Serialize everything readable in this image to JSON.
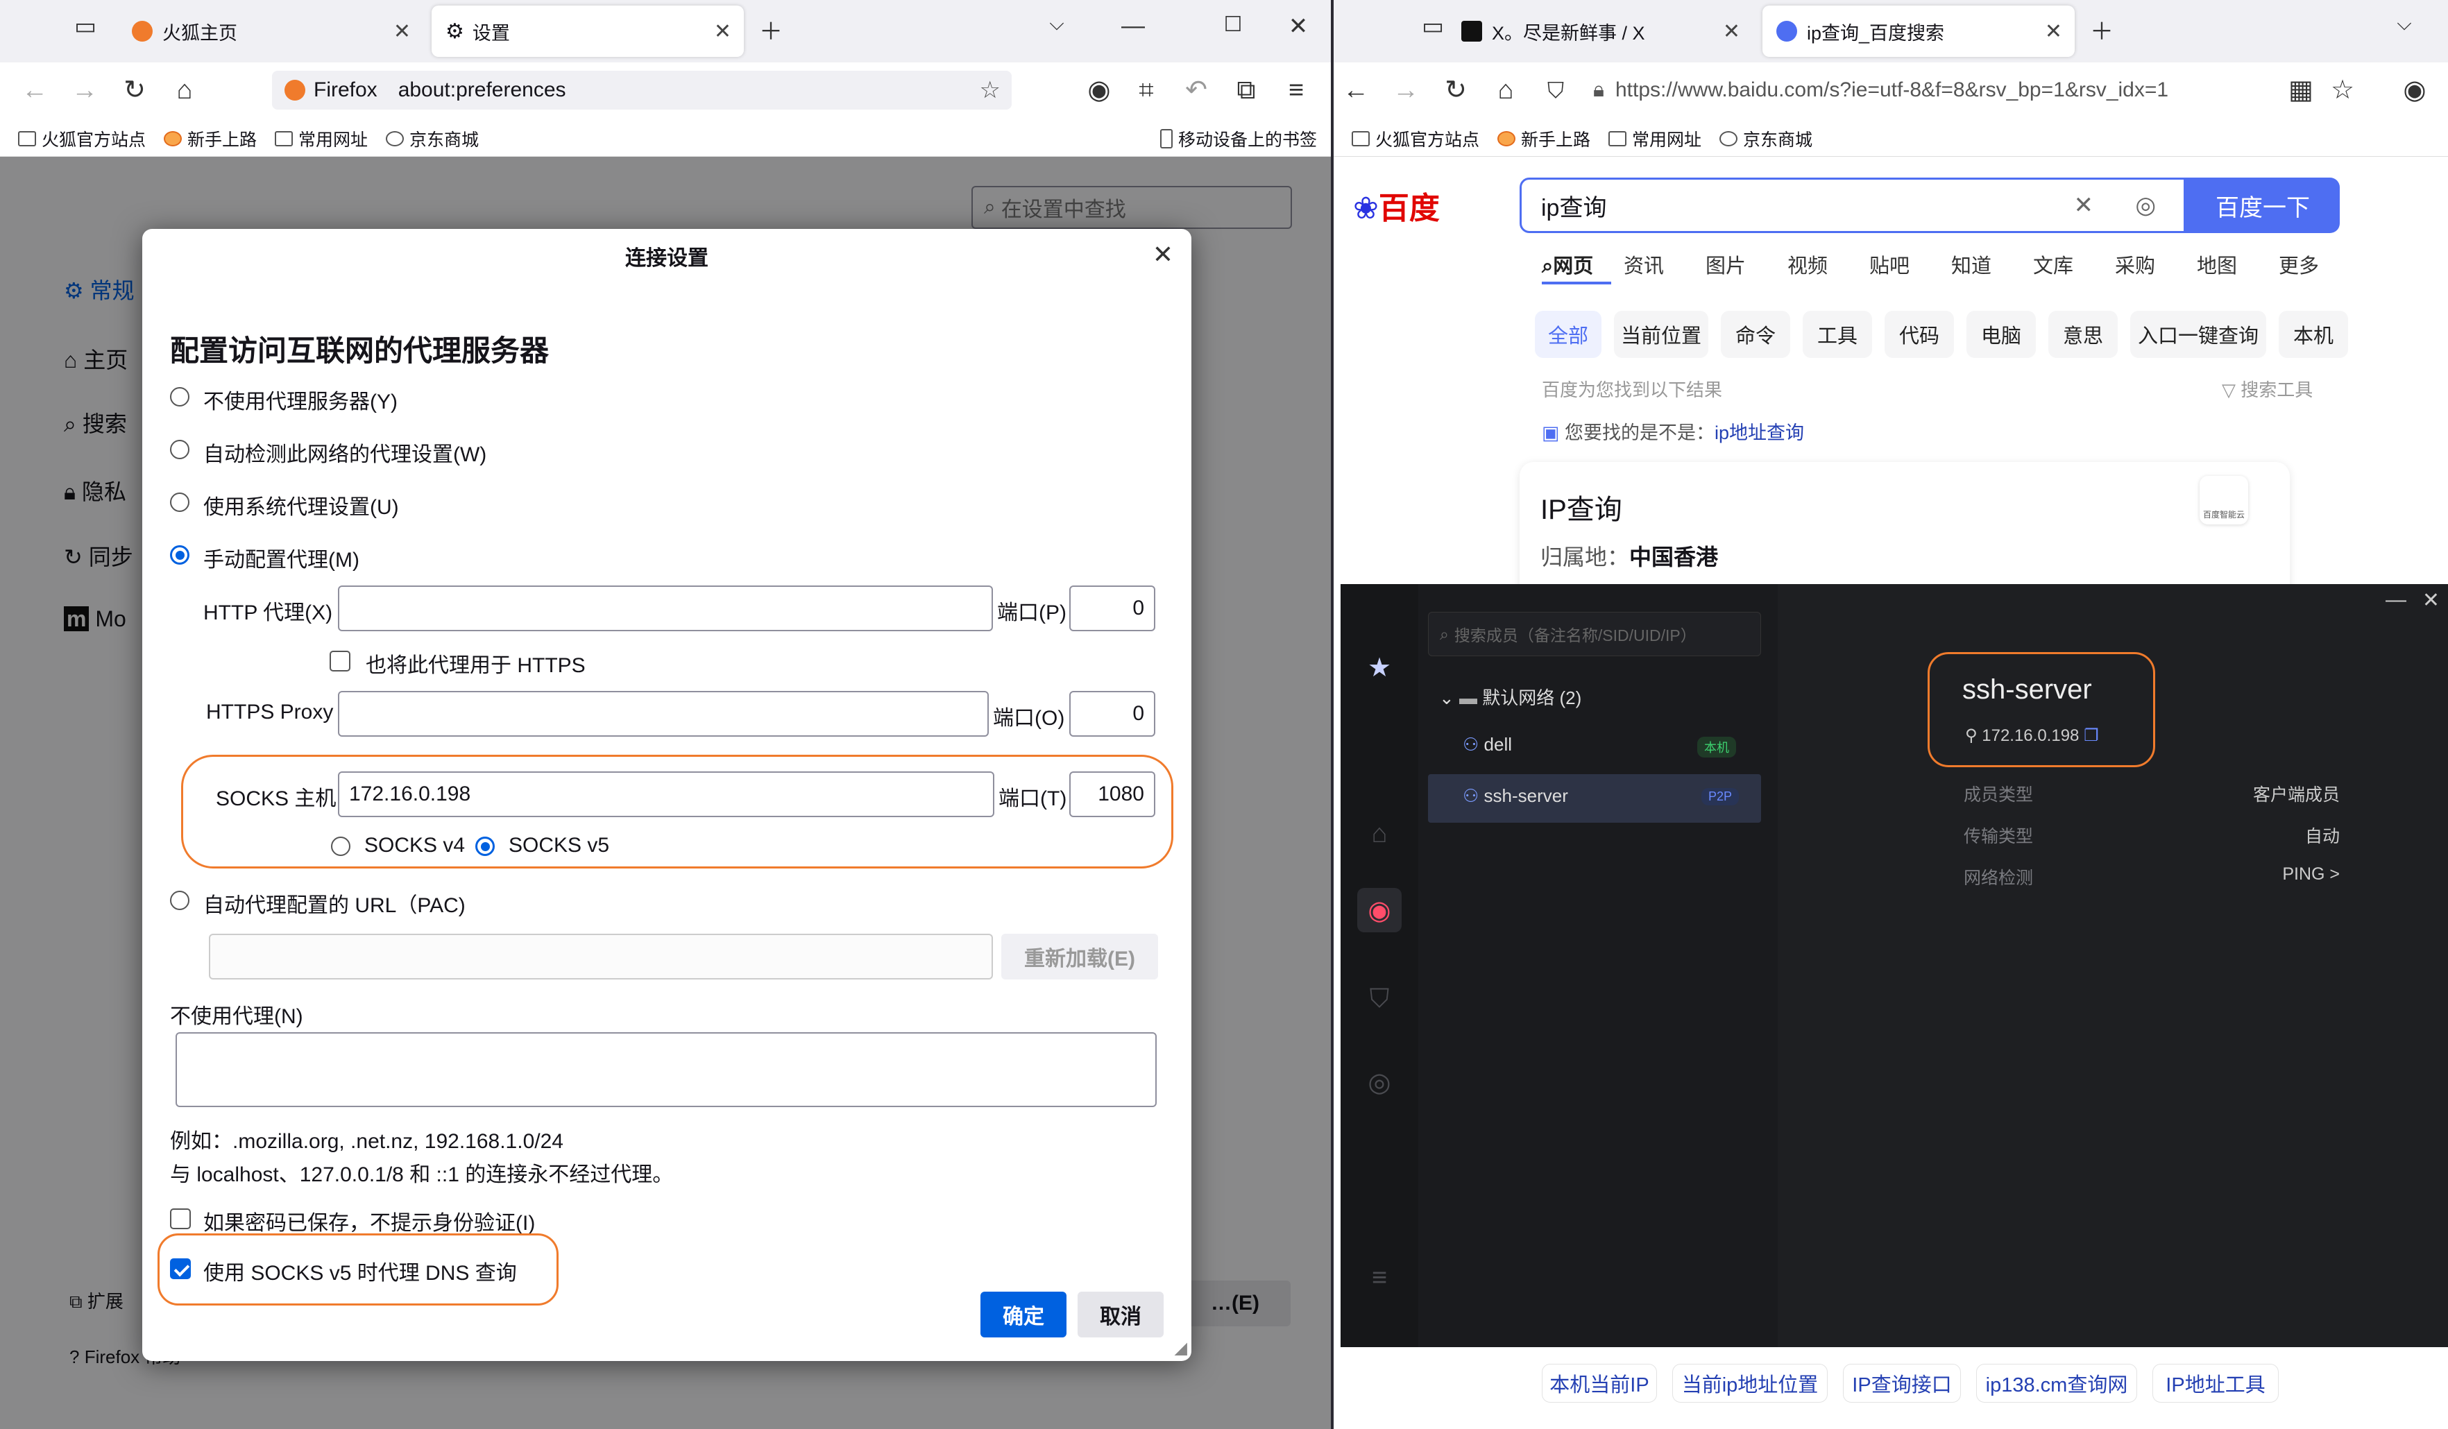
{
  "left_window": {
    "tabs": [
      {
        "title": "火狐主页"
      },
      {
        "title": "设置"
      }
    ],
    "urlbar": {
      "identity": "Firefox",
      "url": "about:preferences"
    },
    "bookmarks": [
      "火狐官方站点",
      "新手上路",
      "常用网址",
      "京东商城"
    ],
    "mobile_bookmarks": "移动设备上的书签",
    "prefs": {
      "search_placeholder": "在设置中查找",
      "nav": [
        "常规",
        "主页",
        "搜索",
        "隐私",
        "同步",
        "Mo"
      ],
      "footer": [
        "扩展",
        "Firefox 帮助"
      ],
      "right_btn": "…(E)"
    },
    "dialog": {
      "title": "连接设置",
      "heading": "配置访问互联网的代理服务器",
      "options": {
        "no_proxy": "不使用代理服务器(Y)",
        "auto_detect": "自动检测此网络的代理设置(W)",
        "system": "使用系统代理设置(U)",
        "manual": "手动配置代理(M)",
        "pac": "自动代理配置的 URL（PAC)"
      },
      "selected_option": "manual",
      "http_label": "HTTP 代理(X)",
      "http_value": "",
      "http_port_label": "端口(P)",
      "http_port": "0",
      "also_https": "也将此代理用于 HTTPS",
      "https_label": "HTTPS Proxy",
      "https_value": "",
      "https_port_label": "端口(O)",
      "https_port": "0",
      "socks_label": "SOCKS 主机",
      "socks_value": "172.16.0.198",
      "socks_port_label": "端口(T)",
      "socks_port": "1080",
      "socks_v4": "SOCKS v4",
      "socks_v5": "SOCKS v5",
      "socks_version": "v5",
      "pac_value": "",
      "reload": "重新加载(E)",
      "no_proxy_for": "不使用代理(N)",
      "no_proxy_value": "",
      "example": "例如：.mozilla.org, .net.nz, 192.168.1.0/24",
      "localhost_note": "与 localhost、127.0.0.1/8 和 ::1 的连接永不经过代理。",
      "no_auth_prompt": "如果密码已保存，不提示身份验证(I)",
      "no_auth_checked": false,
      "socks_dns": "使用 SOCKS v5 时代理 DNS 查询",
      "socks_dns_checked": true,
      "ok": "确定",
      "cancel": "取消"
    }
  },
  "right_window": {
    "tabs": [
      {
        "title": "X。尽是新鲜事 / X"
      },
      {
        "title": "ip查询_百度搜索"
      }
    ],
    "url": "https://www.baidu.com/s?ie=utf-8&f=8&rsv_bp=1&rsv_idx=1",
    "bookmarks": [
      "火狐官方站点",
      "新手上路",
      "常用网址",
      "京东商城"
    ],
    "baidu": {
      "logo_text": "百度",
      "query": "ip查询",
      "search_button": "百度一下",
      "tabs": [
        "网页",
        "资讯",
        "图片",
        "视频",
        "贴吧",
        "知道",
        "文库",
        "采购",
        "地图",
        "更多"
      ],
      "pills": [
        "全部",
        "当前位置",
        "命令",
        "工具",
        "代码",
        "电脑",
        "意思",
        "入口一键查询",
        "本机"
      ],
      "result_count": "百度为您找到以下结果",
      "filter": "搜索工具",
      "did_you_mean_prefix": "您要找的是不是：",
      "did_you_mean_link": "ip地址查询",
      "card_title": "IP查询",
      "location_label": "归属地：",
      "location_value": "中国香港",
      "card_badge": "百度智能云",
      "bottom_links": [
        "本机当前IP",
        "当前ip地址位置",
        "IP查询接口",
        "ip138.cm查询网",
        "IP地址工具"
      ]
    }
  },
  "vpn_app": {
    "search_placeholder": "搜索成员（备注名称/SID/UID/IP）",
    "group": "默认网络 (2)",
    "members": [
      {
        "name": "dell",
        "tag": "本机"
      },
      {
        "name": "ssh-server",
        "tag": "P2P"
      }
    ],
    "detail": {
      "name": "ssh-server",
      "ip": "172.16.0.198",
      "rows": [
        {
          "k": "成员类型",
          "v": "客户端成员"
        },
        {
          "k": "传输类型",
          "v": "自动"
        },
        {
          "k": "网络检测",
          "v": "PING >"
        }
      ]
    }
  },
  "colors": {
    "accent": "#0061e0",
    "highlight": "#f07b2c",
    "baidu_blue": "#4e6ef2"
  }
}
